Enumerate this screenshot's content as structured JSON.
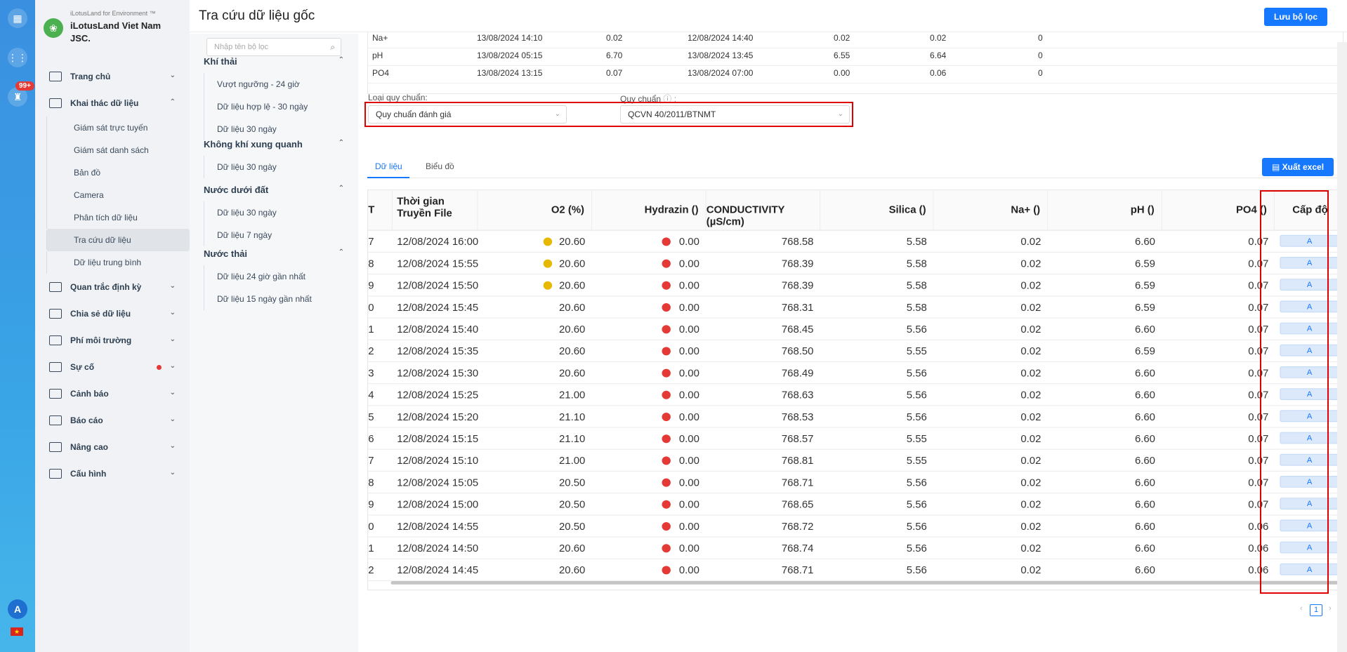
{
  "brand": {
    "sub": "iLotusLand for Environment ™",
    "name": "iLotusLand Viet Nam JSC."
  },
  "rail": {
    "badge": "99+",
    "avatar": "A",
    "flag": "★"
  },
  "menu": [
    {
      "label": "Trang chủ",
      "chev": "⌄"
    },
    {
      "label": "Khai thác dữ liệu",
      "chev": "⌃"
    },
    {
      "label": "Quan trắc định kỳ",
      "chev": "⌄"
    },
    {
      "label": "Chia sẻ dữ liệu",
      "chev": "⌄"
    },
    {
      "label": "Phí môi trường",
      "chev": "⌄"
    },
    {
      "label": "Sự cố",
      "chev": "⌄"
    },
    {
      "label": "Cảnh báo",
      "chev": "⌄"
    },
    {
      "label": "Báo cáo",
      "chev": "⌄"
    },
    {
      "label": "Nâng cao",
      "chev": "⌄"
    },
    {
      "label": "Cấu hình",
      "chev": "⌄"
    }
  ],
  "submenu": [
    "Giám sát trực tuyến",
    "Giám sát danh sách",
    "Bản đồ",
    "Camera",
    "Phân tích dữ liệu",
    "Tra cứu dữ liệu",
    "Dữ liệu trung bình"
  ],
  "filter": {
    "placeholder": "Nhập tên bộ lọc",
    "search_icon": "⌕",
    "groups": [
      {
        "title": "Khí thải",
        "items": [
          "Vượt ngưỡng - 24 giờ",
          "Dữ liệu hợp lệ - 30 ngày",
          "Dữ liệu 30 ngày"
        ]
      },
      {
        "title": "Không khí xung quanh",
        "items": [
          "Dữ liệu 30 ngày"
        ]
      },
      {
        "title": "Nước dưới đất",
        "items": [
          "Dữ liệu 30 ngày",
          "Dữ liệu 7 ngày"
        ]
      },
      {
        "title": "Nước thải",
        "items": [
          "Dữ liệu 24 giờ gần nhất",
          "Dữ liệu 15 ngày gần nhất"
        ]
      }
    ]
  },
  "page": {
    "title": "Tra cứu dữ liệu gốc",
    "save_label": "Lưu bộ lọc"
  },
  "summary_rows": [
    [
      "Na+",
      "13/08/2024 14:10",
      "0.02",
      "12/08/2024 14:40",
      "0.02",
      "0.02",
      "0"
    ],
    [
      "pH",
      "13/08/2024 05:15",
      "6.70",
      "13/08/2024 13:45",
      "6.55",
      "6.64",
      "0"
    ],
    [
      "PO4",
      "13/08/2024 13:15",
      "0.07",
      "13/08/2024 07:00",
      "0.00",
      "0.06",
      "0"
    ]
  ],
  "standard": {
    "type_label": "Loại quy chuẩn:",
    "type_value": "Quy chuẩn đánh giá",
    "std_label": "Quy chuẩn",
    "std_info": "ⓘ :",
    "std_value": "QCVN 40/2011/BTNMT"
  },
  "tabs": {
    "data": "Dữ liệu",
    "chart": "Biểu đồ",
    "export": "Xuất excel"
  },
  "columns": [
    "T",
    "Thời gian Truyền File",
    "O2 (%)",
    "Hydrazin ()",
    "CONDUCTIVITY (µS/cm)",
    "Silica ()",
    "Na+ ()",
    "pH ()",
    "PO4 ()",
    "Cấp độ"
  ],
  "rows": [
    [
      "7",
      "12/08/2024 16:00",
      "20.60",
      "0.00",
      "768.58",
      "5.58",
      "0.02",
      "6.60",
      "0.07",
      "A"
    ],
    [
      "8",
      "12/08/2024 15:55",
      "20.60",
      "0.00",
      "768.39",
      "5.58",
      "0.02",
      "6.59",
      "0.07",
      "A"
    ],
    [
      "9",
      "12/08/2024 15:50",
      "20.60",
      "0.00",
      "768.39",
      "5.58",
      "0.02",
      "6.59",
      "0.07",
      "A"
    ],
    [
      "0",
      "12/08/2024 15:45",
      "20.60",
      "0.00",
      "768.31",
      "5.58",
      "0.02",
      "6.59",
      "0.07",
      "A"
    ],
    [
      "1",
      "12/08/2024 15:40",
      "20.60",
      "0.00",
      "768.45",
      "5.56",
      "0.02",
      "6.60",
      "0.07",
      "A"
    ],
    [
      "2",
      "12/08/2024 15:35",
      "20.60",
      "0.00",
      "768.50",
      "5.55",
      "0.02",
      "6.59",
      "0.07",
      "A"
    ],
    [
      "3",
      "12/08/2024 15:30",
      "20.60",
      "0.00",
      "768.49",
      "5.56",
      "0.02",
      "6.60",
      "0.07",
      "A"
    ],
    [
      "4",
      "12/08/2024 15:25",
      "21.00",
      "0.00",
      "768.63",
      "5.56",
      "0.02",
      "6.60",
      "0.07",
      "A"
    ],
    [
      "5",
      "12/08/2024 15:20",
      "21.10",
      "0.00",
      "768.53",
      "5.56",
      "0.02",
      "6.60",
      "0.07",
      "A"
    ],
    [
      "6",
      "12/08/2024 15:15",
      "21.10",
      "0.00",
      "768.57",
      "5.55",
      "0.02",
      "6.60",
      "0.07",
      "A"
    ],
    [
      "7",
      "12/08/2024 15:10",
      "21.00",
      "0.00",
      "768.81",
      "5.55",
      "0.02",
      "6.60",
      "0.07",
      "A"
    ],
    [
      "8",
      "12/08/2024 15:05",
      "20.50",
      "0.00",
      "768.71",
      "5.56",
      "0.02",
      "6.60",
      "0.07",
      "A"
    ],
    [
      "9",
      "12/08/2024 15:00",
      "20.50",
      "0.00",
      "768.65",
      "5.56",
      "0.02",
      "6.60",
      "0.07",
      "A"
    ],
    [
      "0",
      "12/08/2024 14:55",
      "20.50",
      "0.00",
      "768.72",
      "5.56",
      "0.02",
      "6.60",
      "0.06",
      "A"
    ],
    [
      "1",
      "12/08/2024 14:50",
      "20.60",
      "0.00",
      "768.74",
      "5.56",
      "0.02",
      "6.60",
      "0.06",
      "A"
    ],
    [
      "2",
      "12/08/2024 14:45",
      "20.60",
      "0.00",
      "768.71",
      "5.56",
      "0.02",
      "6.60",
      "0.06",
      "A"
    ]
  ],
  "o2_dot_rows": [
    0,
    1,
    2
  ],
  "colors": {
    "accent": "#1677ff",
    "warn": "#e6b800",
    "danger": "#e53935",
    "highlight": "#e00000"
  },
  "pager": {
    "prev": "‹",
    "page": "1",
    "next": "›"
  }
}
